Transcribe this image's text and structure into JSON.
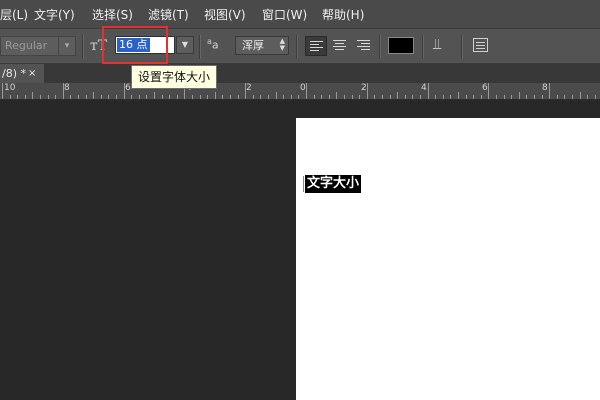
{
  "menubar": {
    "items": [
      {
        "label": "层(L)"
      },
      {
        "label": "文字(Y)"
      },
      {
        "label": "选择(S)"
      },
      {
        "label": "滤镜(T)"
      },
      {
        "label": "视图(V)"
      },
      {
        "label": "窗口(W)"
      },
      {
        "label": "帮助(H)"
      }
    ]
  },
  "options": {
    "font_style": "Regular",
    "font_size": "16 点",
    "anti_alias": "浑厚",
    "text_color": "#000000"
  },
  "tooltip": "设置字体大小",
  "document_tab": {
    "label": "/8) *",
    "close": "×"
  },
  "ruler": {
    "labels": [
      "10",
      "8",
      "6",
      "4",
      "2",
      "0",
      "2",
      "4",
      "6",
      "8"
    ]
  },
  "canvas": {
    "text": "文字大小"
  },
  "icons": {
    "size": "font-size-icon",
    "aa": "anti-alias-icon",
    "warp": "warp-text-icon",
    "panel": "character-panel-icon"
  }
}
